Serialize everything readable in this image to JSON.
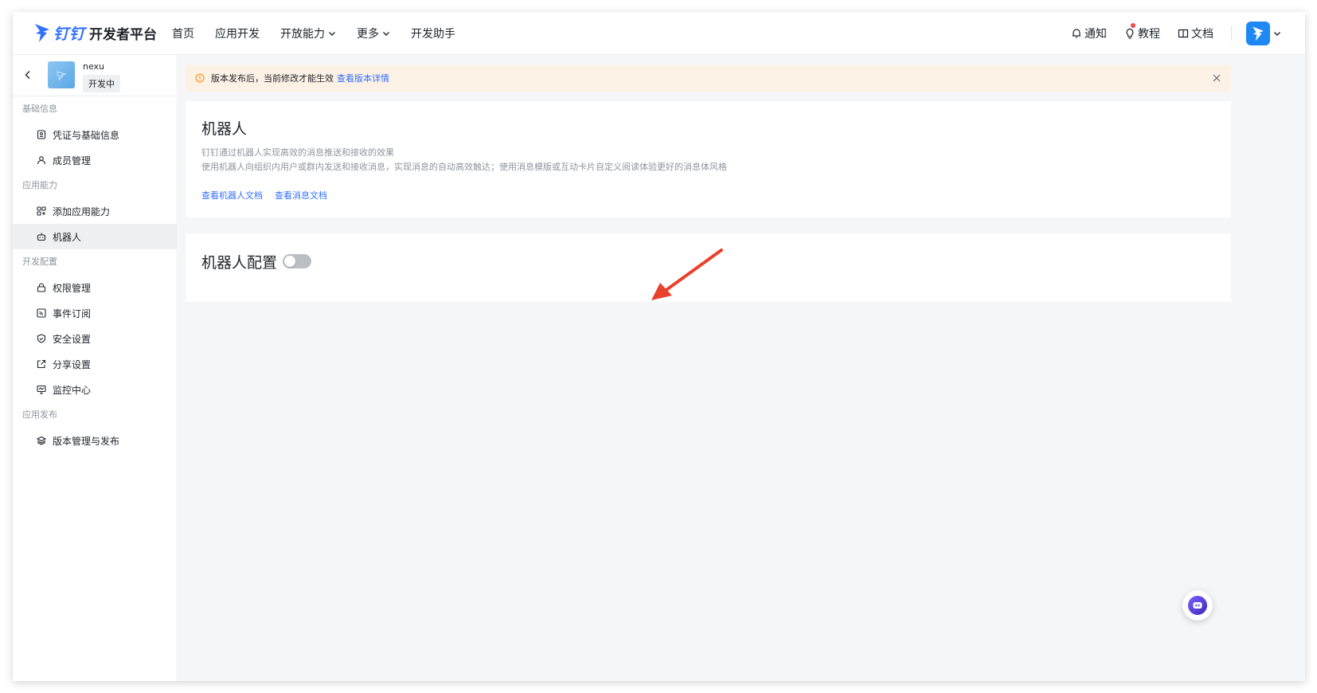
{
  "header": {
    "brand": "钉钉",
    "platform": "开发者平台",
    "nav": [
      {
        "label": "首页",
        "dropdown": false
      },
      {
        "label": "应用开发",
        "dropdown": false
      },
      {
        "label": "开放能力",
        "dropdown": true
      },
      {
        "label": "更多",
        "dropdown": true
      },
      {
        "label": "开发助手",
        "dropdown": false
      }
    ],
    "notify_label": "通知",
    "tutorial_label": "教程",
    "docs_label": "文档"
  },
  "sidebar": {
    "app_name": "nexu",
    "app_status": "开发中",
    "groups": [
      {
        "title": "基础信息",
        "items": [
          {
            "label": "凭证与基础信息",
            "icon": "credential-icon"
          },
          {
            "label": "成员管理",
            "icon": "user-icon"
          }
        ]
      },
      {
        "title": "应用能力",
        "items": [
          {
            "label": "添加应用能力",
            "icon": "grid-add-icon"
          },
          {
            "label": "机器人",
            "icon": "robot-icon",
            "active": true
          }
        ]
      },
      {
        "title": "开发配置",
        "items": [
          {
            "label": "权限管理",
            "icon": "lock-icon"
          },
          {
            "label": "事件订阅",
            "icon": "rss-icon"
          },
          {
            "label": "安全设置",
            "icon": "shield-icon"
          },
          {
            "label": "分享设置",
            "icon": "share-icon"
          },
          {
            "label": "监控中心",
            "icon": "monitor-icon"
          }
        ]
      },
      {
        "title": "应用发布",
        "items": [
          {
            "label": "版本管理与发布",
            "icon": "layers-icon"
          }
        ]
      }
    ]
  },
  "alert": {
    "text": "版本发布后，当前修改才能生效",
    "link": "查看版本详情"
  },
  "robot_card": {
    "title": "机器人",
    "desc1": "钉钉通过机器人实现高效的消息推送和接收的效果",
    "desc2": "使用机器人向组织内用户或群内发送和接收消息，实现消息的自动高效触达；使用消息模版或互动卡片自定义阅读体验更好的消息体风格",
    "link1": "查看机器人文档",
    "link2": "查看消息文档"
  },
  "config_card": {
    "title": "机器人配置",
    "toggle_on": false
  },
  "colors": {
    "accent": "#3370ff",
    "alert_bg": "#fcf1e5",
    "annotation_arrow": "#e8412c"
  }
}
